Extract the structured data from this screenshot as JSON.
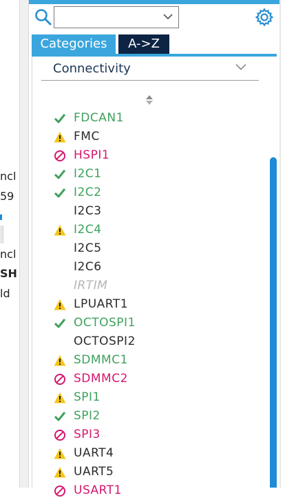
{
  "left_clip": {
    "lines": [
      "ncl",
      "59",
      "ncl",
      "SH",
      "ld"
    ]
  },
  "search": {
    "value": "",
    "placeholder": ""
  },
  "tabs": [
    {
      "label": "Categories",
      "active": true
    },
    {
      "label": "A->Z",
      "active": false
    }
  ],
  "category": {
    "selected": "Connectivity"
  },
  "peripherals": [
    {
      "name": "FDCAN1",
      "status": "ok"
    },
    {
      "name": "FMC",
      "status": "warn"
    },
    {
      "name": "HSPI1",
      "status": "block"
    },
    {
      "name": "I2C1",
      "status": "ok"
    },
    {
      "name": "I2C2",
      "status": "ok"
    },
    {
      "name": "I2C3",
      "status": "none"
    },
    {
      "name": "I2C4",
      "status": "warn-green"
    },
    {
      "name": "I2C5",
      "status": "none"
    },
    {
      "name": "I2C6",
      "status": "none"
    },
    {
      "name": "IRTIM",
      "status": "disabled"
    },
    {
      "name": "LPUART1",
      "status": "warn"
    },
    {
      "name": "OCTOSPI1",
      "status": "ok"
    },
    {
      "name": "OCTOSPI2",
      "status": "none"
    },
    {
      "name": "SDMMC1",
      "status": "warn-green"
    },
    {
      "name": "SDMMC2",
      "status": "block"
    },
    {
      "name": "SPI1",
      "status": "warn-green"
    },
    {
      "name": "SPI2",
      "status": "ok"
    },
    {
      "name": "SPI3",
      "status": "block"
    },
    {
      "name": "UART4",
      "status": "warn"
    },
    {
      "name": "UART5",
      "status": "warn"
    },
    {
      "name": "USART1",
      "status": "block"
    }
  ],
  "colors": {
    "accent": "#3aa6dd",
    "dark_tab": "#0d2444",
    "ok": "#3ea15d",
    "block": "#d4176e",
    "warn": "#f5c518",
    "disabled": "#b5b5b5"
  },
  "icons": {
    "ok": "check-icon",
    "warn": "warning-icon",
    "warn-green": "warning-icon",
    "block": "forbidden-icon"
  }
}
